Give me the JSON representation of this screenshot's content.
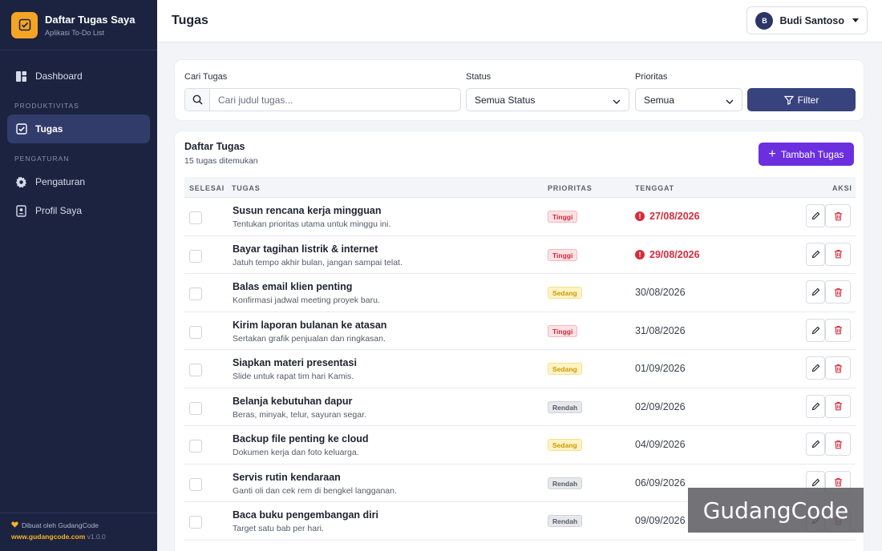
{
  "brand": {
    "title": "Daftar Tugas Saya",
    "subtitle": "Aplikasi To-Do List",
    "logo_icon": "checkbox-icon"
  },
  "sidebar": {
    "dashboard": {
      "label": "Dashboard",
      "icon": "dashboard-icon"
    },
    "section_productivity": "PRODUKTIVITAS",
    "tasks": {
      "label": "Tugas",
      "icon": "checkbox-icon",
      "active": true
    },
    "section_settings": "PENGATURAN",
    "settings": {
      "label": "Pengaturan",
      "icon": "gear-icon"
    },
    "profile": {
      "label": "Profil Saya",
      "icon": "id-card-icon"
    },
    "footer": {
      "made_by": "Dibuat oleh GudangCode",
      "site": "www.gudangcode.com",
      "version": "v1.0.0"
    }
  },
  "header": {
    "title": "Tugas",
    "user": {
      "initial": "B",
      "name": "Budi Santoso"
    }
  },
  "filters": {
    "search_label": "Cari Tugas",
    "search_placeholder": "Cari judul tugas...",
    "status_label": "Status",
    "status_value": "Semua Status",
    "priority_label": "Prioritas",
    "priority_value": "Semua",
    "filter_button": "Filter"
  },
  "list": {
    "title": "Daftar Tugas",
    "count": "15 tugas ditemukan",
    "add_button": "Tambah Tugas",
    "columns": {
      "done": "SELESAI",
      "task": "TUGAS",
      "priority": "PRIORITAS",
      "due": "TENGGAT",
      "actions": "AKSI"
    },
    "rows": [
      {
        "title": "Susun rencana kerja mingguan",
        "desc": "Tentukan prioritas utama untuk minggu ini.",
        "priority": "Tinggi",
        "level": "high",
        "due": "27/08/2026",
        "overdue": true
      },
      {
        "title": "Bayar tagihan listrik & internet",
        "desc": "Jatuh tempo akhir bulan, jangan sampai telat.",
        "priority": "Tinggi",
        "level": "high",
        "due": "29/08/2026",
        "overdue": true
      },
      {
        "title": "Balas email klien penting",
        "desc": "Konfirmasi jadwal meeting proyek baru.",
        "priority": "Sedang",
        "level": "med",
        "due": "30/08/2026",
        "overdue": false
      },
      {
        "title": "Kirim laporan bulanan ke atasan",
        "desc": "Sertakan grafik penjualan dan ringkasan.",
        "priority": "Tinggi",
        "level": "high",
        "due": "31/08/2026",
        "overdue": false
      },
      {
        "title": "Siapkan materi presentasi",
        "desc": "Slide untuk rapat tim hari Kamis.",
        "priority": "Sedang",
        "level": "med",
        "due": "01/09/2026",
        "overdue": false
      },
      {
        "title": "Belanja kebutuhan dapur",
        "desc": "Beras, minyak, telur, sayuran segar.",
        "priority": "Rendah",
        "level": "low",
        "due": "02/09/2026",
        "overdue": false
      },
      {
        "title": "Backup file penting ke cloud",
        "desc": "Dokumen kerja dan foto keluarga.",
        "priority": "Sedang",
        "level": "med",
        "due": "04/09/2026",
        "overdue": false
      },
      {
        "title": "Servis rutin kendaraan",
        "desc": "Ganti oli dan cek rem di bengkel langganan.",
        "priority": "Rendah",
        "level": "low",
        "due": "06/09/2026",
        "overdue": false
      },
      {
        "title": "Baca buku pengembangan diri",
        "desc": "Target satu bab per hari.",
        "priority": "Rendah",
        "level": "low",
        "due": "09/09/2026",
        "overdue": false
      }
    ]
  },
  "watermark": "GudangCode",
  "colors": {
    "sidebar_bg": "#1c2340",
    "accent": "#f5a524",
    "primary": "#38427d",
    "add_button": "#6b2fe0",
    "danger": "#d52d3d"
  }
}
